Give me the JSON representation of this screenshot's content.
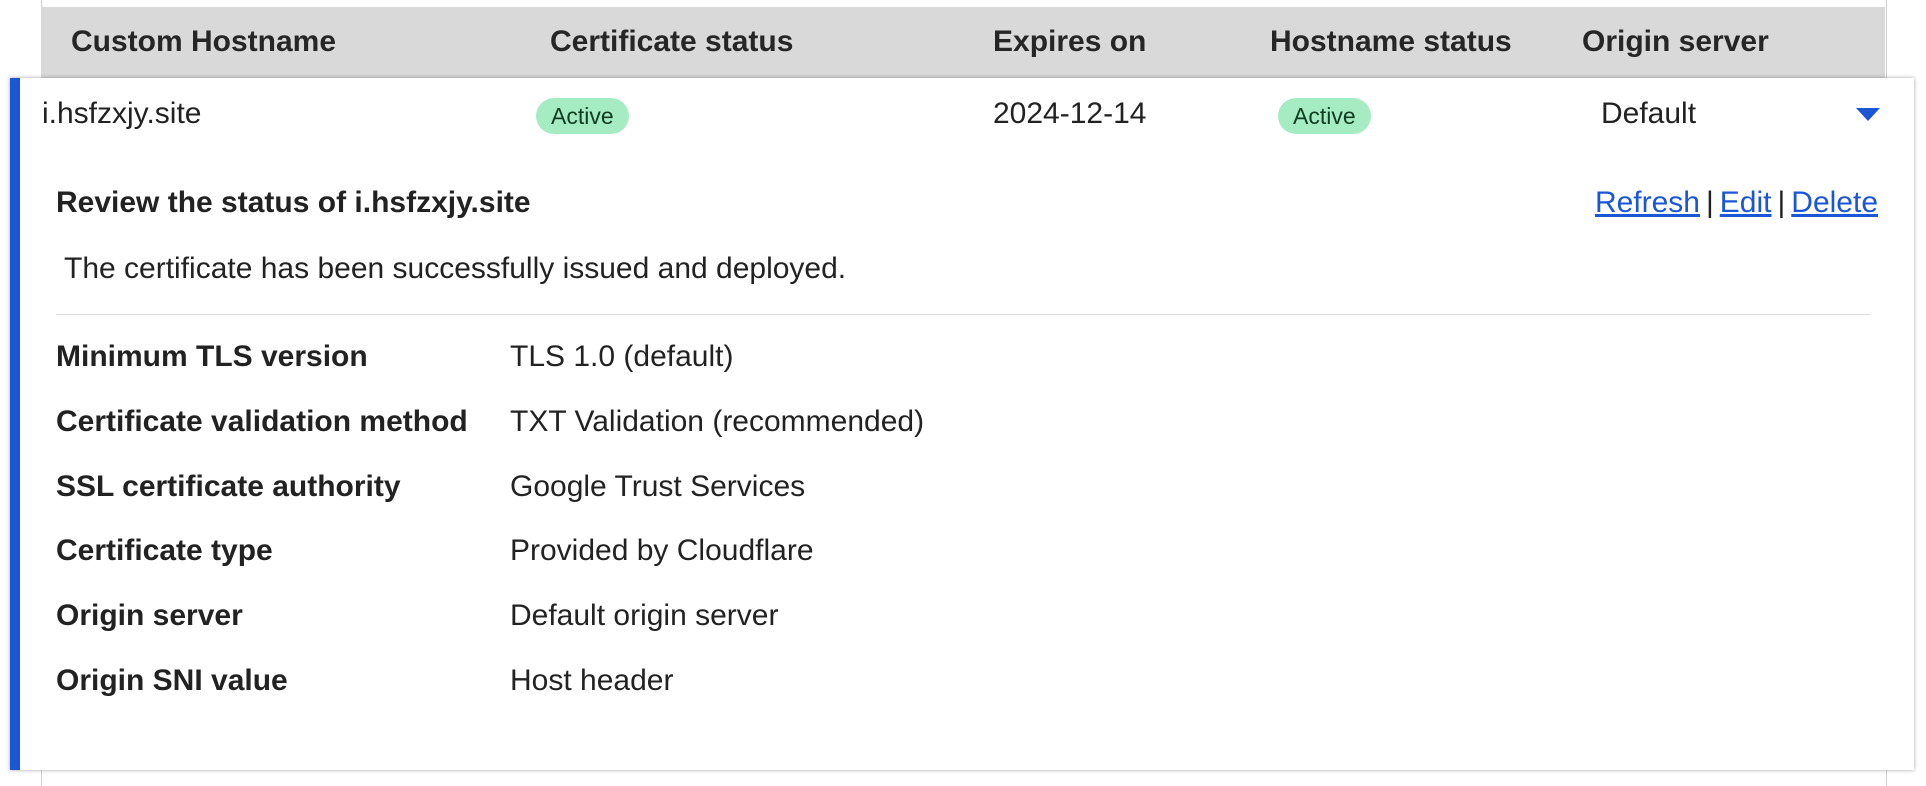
{
  "table": {
    "headers": {
      "hostname": "Custom Hostname",
      "cert_status": "Certificate status",
      "expires": "Expires on",
      "hostname_status": "Hostname status",
      "origin": "Origin server"
    },
    "row": {
      "hostname": "i.hsfzxjy.site",
      "cert_status": "Active",
      "expires": "2024-12-14",
      "hostname_status": "Active",
      "origin": "Default"
    }
  },
  "details": {
    "title": "Review the status of i.hsfzxjy.site",
    "actions": {
      "refresh": "Refresh",
      "edit": "Edit",
      "delete": "Delete",
      "separator": "|"
    },
    "message": "The certificate has been successfully issued and deployed.",
    "fields": [
      {
        "label": "Minimum TLS version",
        "value": "TLS 1.0 (default)"
      },
      {
        "label": "Certificate validation method",
        "value": "TXT Validation (recommended)"
      },
      {
        "label": "SSL certificate authority",
        "value": "Google Trust Services"
      },
      {
        "label": "Certificate type",
        "value": "Provided by Cloudflare"
      },
      {
        "label": "Origin server",
        "value": "Default origin server"
      },
      {
        "label": "Origin SNI value",
        "value": "Host header"
      }
    ]
  },
  "colors": {
    "accent": "#1a56d6",
    "badge_bg": "#a6ecc3",
    "header_bg": "#d9d9d9"
  }
}
